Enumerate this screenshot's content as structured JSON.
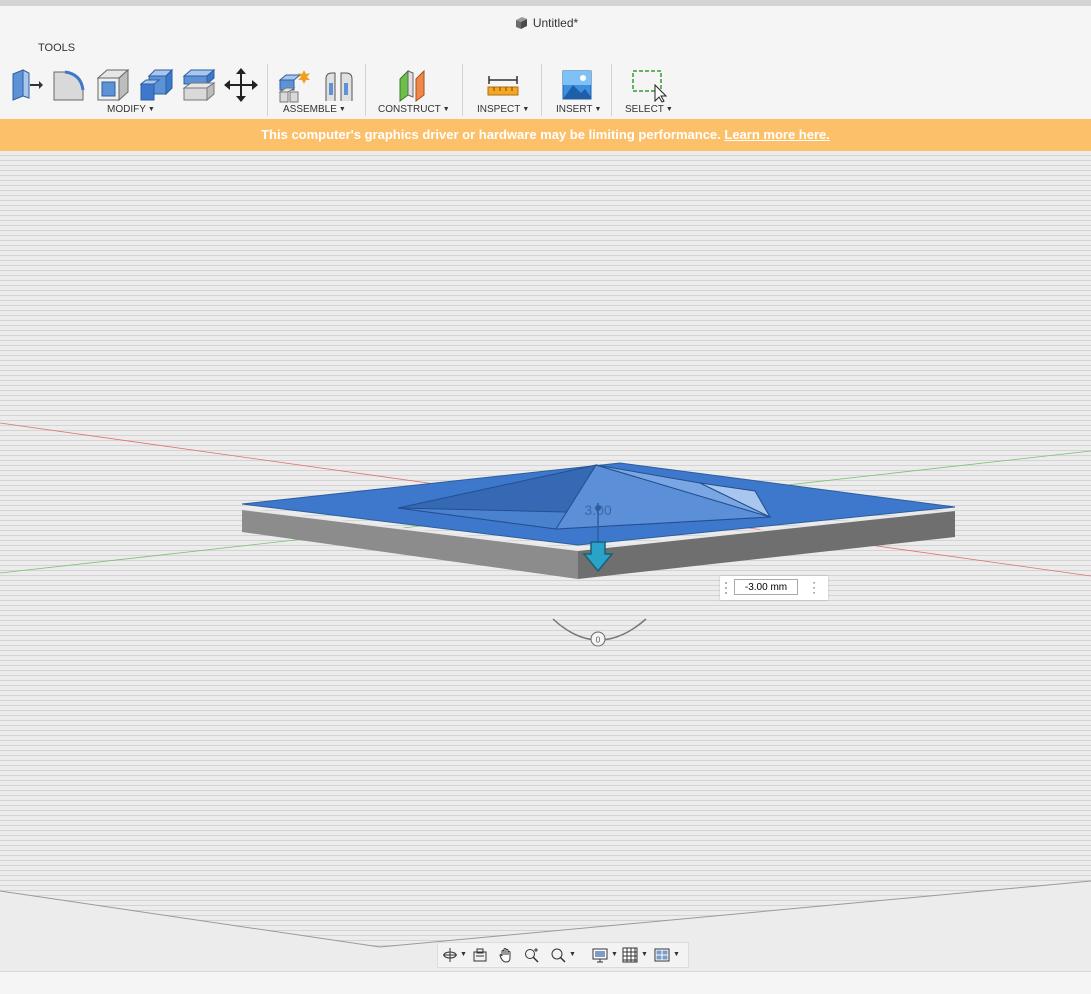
{
  "window": {
    "title": "Untitled*"
  },
  "toolbar": {
    "tools_label": "TOOLS",
    "groups": [
      {
        "label": "MODIFY"
      },
      {
        "label": "ASSEMBLE"
      },
      {
        "label": "CONSTRUCT"
      },
      {
        "label": "INSPECT"
      },
      {
        "label": "INSERT"
      },
      {
        "label": "SELECT"
      }
    ]
  },
  "banner": {
    "message": "This computer's graphics driver or hardware may be limiting performance. ",
    "link": "Learn more here.",
    "color": "#fdc06a"
  },
  "viewport": {
    "dimension_input": "-3.00 mm",
    "dimension_tag": "3.00",
    "rotation_handle_value": "0",
    "model_color": "#3d78cc"
  },
  "icons": {
    "modify": [
      "press-pull-icon",
      "fillet-icon",
      "shell-icon",
      "combine-icon",
      "offset-face-icon",
      "move-icon"
    ],
    "assemble": [
      "new-component-icon",
      "joint-icon"
    ],
    "construct": [
      "offset-plane-icon"
    ],
    "inspect": [
      "measure-icon"
    ],
    "insert": [
      "insert-image-icon"
    ],
    "select": [
      "window-select-icon"
    ],
    "navbar": [
      "orbit-icon",
      "look-at-icon",
      "pan-icon",
      "zoom-icon",
      "fit-icon",
      "display-settings-icon",
      "grid-settings-icon",
      "viewports-icon"
    ]
  }
}
